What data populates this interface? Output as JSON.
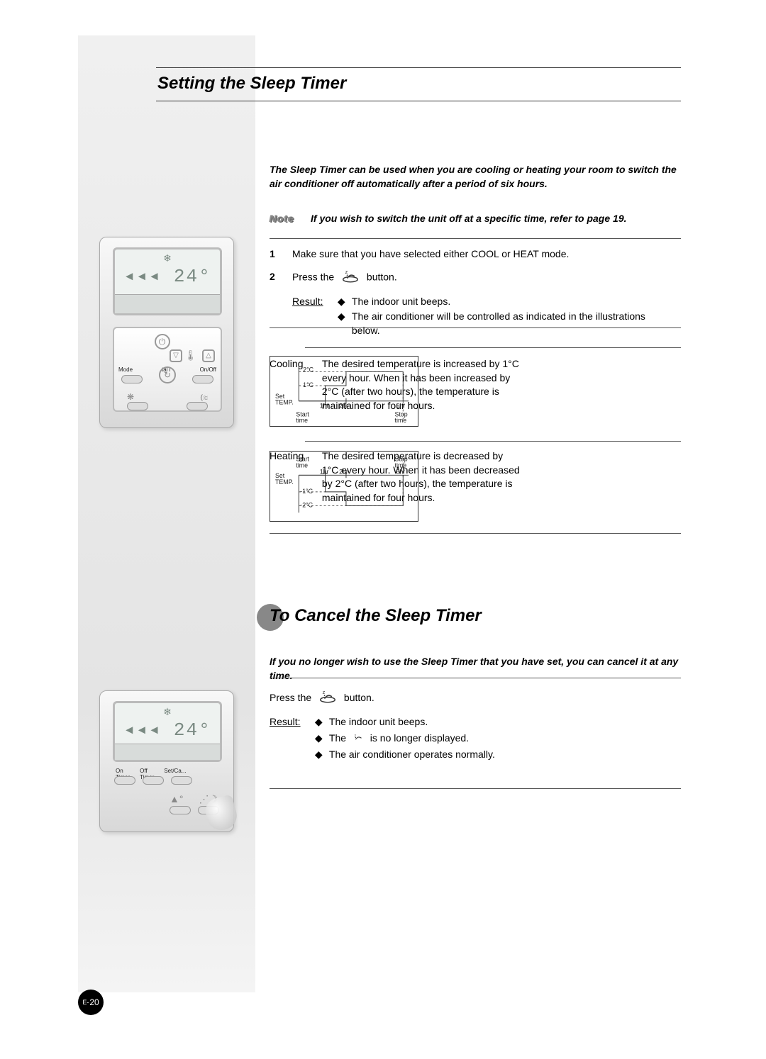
{
  "title": "Setting the Sleep Timer",
  "intro": "The Sleep Timer can be used when you are cooling or heating your room to switch the air conditioner off automatically after a period of six hours.",
  "note": {
    "label": "Note",
    "text": "If you wish to switch the unit off at a specific time, refer to page 19."
  },
  "steps": {
    "s1": {
      "num": "1",
      "text": "Make sure that you have selected either COOL or HEAT mode."
    },
    "s2": {
      "num": "2",
      "before": "Press the",
      "after": "button.",
      "result_label": "Result:",
      "bullets": [
        "The indoor unit beeps.",
        "The air conditioner will be controlled as indicated in the illustrations below."
      ]
    }
  },
  "modes": {
    "cooling": {
      "label": "Cooling",
      "text": "The desired temperature is increased by 1°C every hour. When it has been increased by 2°C (after two hours), the temperature is maintained for four hours."
    },
    "heating": {
      "label": "Heating",
      "text": "The desired temperature is decreased by 1°C every hour. When it has been decreased by 2°C (after two hours), the temperature is maintained for four hours."
    }
  },
  "chart_data": [
    {
      "type": "line",
      "name": "cooling",
      "xlabel_left": "Start\ntime",
      "xlabel_right": "Stop\ntime",
      "set_temp_label": "Set\nTEMP.",
      "x_ticks": [
        "1hr",
        "2hr",
        "6hr"
      ],
      "y_ticks": [
        "1°C",
        "2°C"
      ],
      "points": [
        [
          0,
          0
        ],
        [
          1,
          1
        ],
        [
          2,
          2
        ],
        [
          6,
          2
        ],
        [
          6,
          0
        ]
      ]
    },
    {
      "type": "line",
      "name": "heating",
      "xlabel_left": "Start\ntime",
      "xlabel_right": "Stop\ntime",
      "set_temp_label": "Set\nTEMP.",
      "x_ticks": [
        "1hr",
        "2hr",
        "6hr"
      ],
      "y_ticks": [
        "-1°C",
        "-2°C"
      ],
      "points": [
        [
          0,
          0
        ],
        [
          1,
          -1
        ],
        [
          2,
          -2
        ],
        [
          6,
          -2
        ],
        [
          6,
          0
        ]
      ]
    }
  ],
  "subtitle": "To Cancel the Sleep Timer",
  "intro2": "If you no longer wish to use the Sleep Timer that you have set, you can cancel it at any time.",
  "cancel": {
    "before": "Press the",
    "after": "button.",
    "result_label": "Result:",
    "bullets": {
      "b1": "The indoor unit beeps.",
      "b2_before": "The",
      "b2_after": "is no longer displayed.",
      "b3": "The air conditioner operates normally."
    }
  },
  "remote": {
    "temp_display": "24°",
    "mode_label": "Mode",
    "digital_label": "tal i",
    "onoff_label": "On/Off",
    "on_timer": "On\nTimer",
    "off_timer": "Off\nTimer",
    "set_cancel": "Set/Ca..."
  },
  "page_number": {
    "prefix": "E-",
    "num": "20"
  }
}
